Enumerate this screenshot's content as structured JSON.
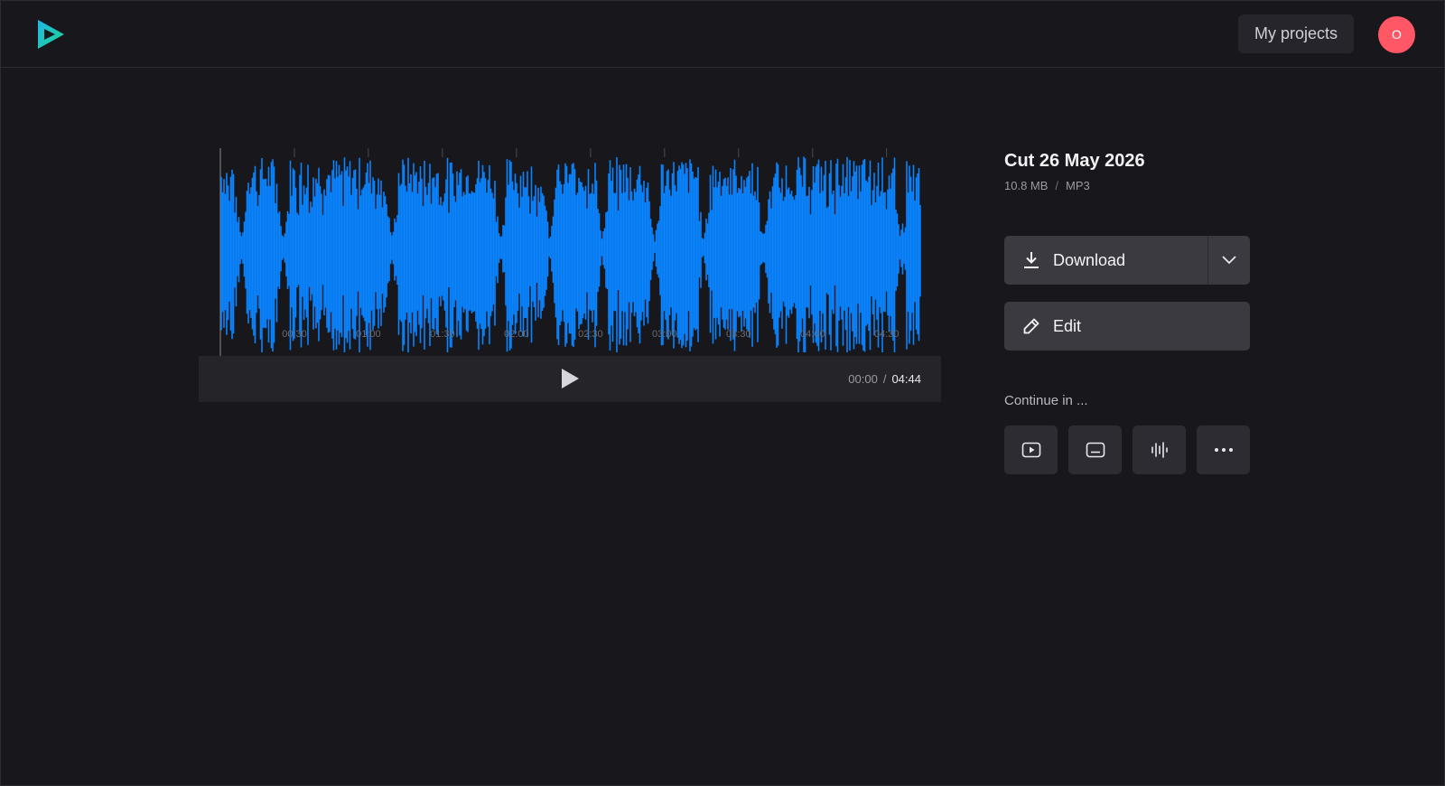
{
  "header": {
    "logo_icon": "play-triangle-logo",
    "projects_label": "My projects",
    "avatar_initial": "O",
    "avatar_color": "#ff5766"
  },
  "player": {
    "waveform_color": "#0a84ff",
    "timeline_ticks": [
      "00:30",
      "01:00",
      "01:30",
      "02:00",
      "02:30",
      "03:00",
      "03:30",
      "04:00",
      "04:30"
    ],
    "current_time": "00:00",
    "time_separator": "/",
    "duration": "04:44",
    "play_icon": "play-icon"
  },
  "file": {
    "title": "Cut 26 May 2026",
    "size": "10.8 MB",
    "meta_separator": "/",
    "format": "MP3"
  },
  "actions": {
    "download_label": "Download",
    "download_icon": "download-icon",
    "download_menu_icon": "chevron-down-icon",
    "edit_label": "Edit",
    "edit_icon": "pencil-icon"
  },
  "continue": {
    "label": "Continue in ...",
    "options": [
      {
        "icon": "video-player-icon"
      },
      {
        "icon": "subtitles-icon"
      },
      {
        "icon": "audio-waveform-icon"
      },
      {
        "icon": "more-icon"
      }
    ]
  }
}
